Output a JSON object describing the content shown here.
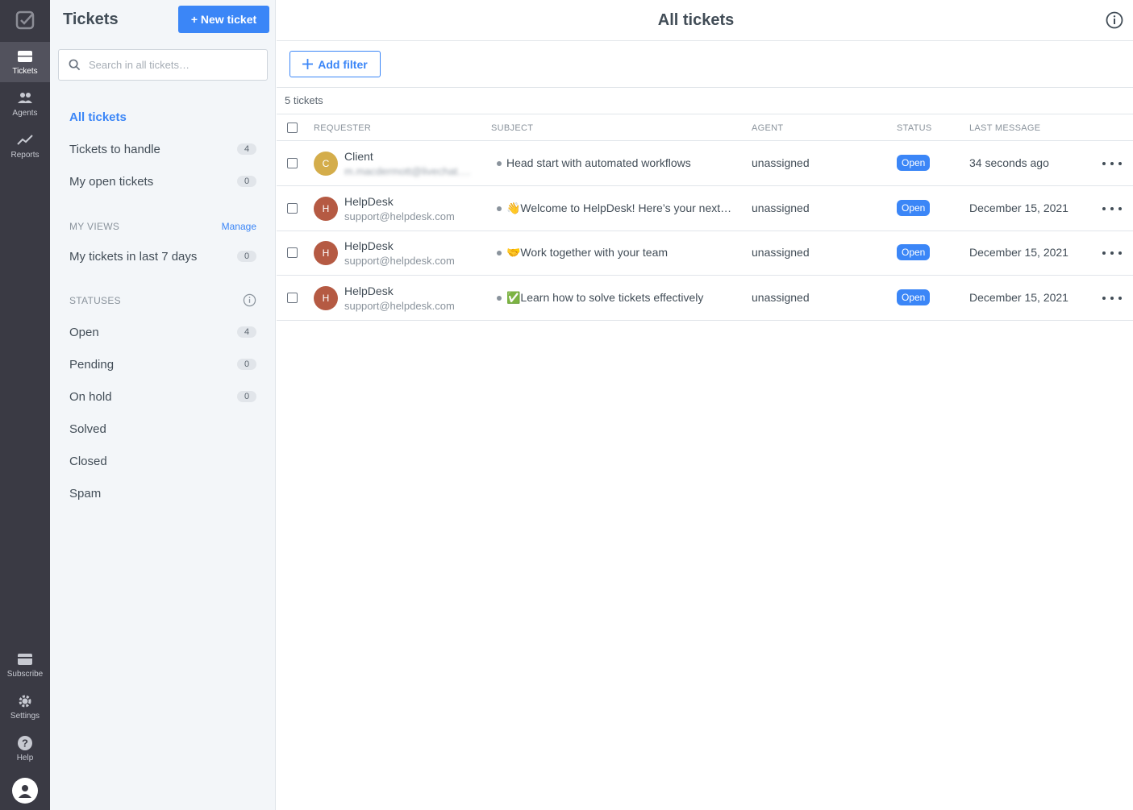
{
  "rail": {
    "items": [
      {
        "label": "Tickets",
        "icon": "ticket-icon"
      },
      {
        "label": "Agents",
        "icon": "agents-icon"
      },
      {
        "label": "Reports",
        "icon": "reports-icon"
      },
      {
        "label": "Subscribe",
        "icon": "subscribe-icon"
      },
      {
        "label": "Settings",
        "icon": "gear-icon"
      },
      {
        "label": "Help",
        "icon": "help-icon"
      }
    ]
  },
  "sidebar": {
    "title": "Tickets",
    "new_ticket_label": "+ New ticket",
    "search_placeholder": "Search in all tickets…",
    "nav": [
      {
        "label": "All tickets",
        "count": ""
      },
      {
        "label": "Tickets to handle",
        "count": "4"
      },
      {
        "label": "My open tickets",
        "count": "0"
      }
    ],
    "my_views": {
      "heading": "MY VIEWS",
      "manage_label": "Manage",
      "items": [
        {
          "label": "My tickets in last 7 days",
          "count": "0"
        }
      ]
    },
    "statuses": {
      "heading": "STATUSES",
      "items": [
        {
          "label": "Open",
          "count": "4"
        },
        {
          "label": "Pending",
          "count": "0"
        },
        {
          "label": "On hold",
          "count": "0"
        },
        {
          "label": "Solved",
          "count": ""
        },
        {
          "label": "Closed",
          "count": ""
        },
        {
          "label": "Spam",
          "count": ""
        }
      ]
    }
  },
  "main": {
    "title": "All tickets",
    "add_filter_label": "Add filter",
    "ticket_count": "5 tickets",
    "columns": [
      "REQUESTER",
      "SUBJECT",
      "AGENT",
      "STATUS",
      "LAST MESSAGE"
    ],
    "rows": [
      {
        "initial": "C",
        "avatar_color": "#d4ad4b",
        "name": "Client",
        "email": "m.macdermott@livechat.c…",
        "email_blurred": true,
        "subject": "Head start with automated workflows",
        "agent": "unassigned",
        "status": "Open",
        "last_message": "34 seconds ago"
      },
      {
        "initial": "H",
        "avatar_color": "#b55a43",
        "name": "HelpDesk",
        "email": "support@helpdesk.com",
        "email_blurred": false,
        "subject": "👋Welcome to HelpDesk! Here’s your next steps",
        "agent": "unassigned",
        "status": "Open",
        "last_message": "December 15, 2021"
      },
      {
        "initial": "H",
        "avatar_color": "#b55a43",
        "name": "HelpDesk",
        "email": "support@helpdesk.com",
        "email_blurred": false,
        "subject": "🤝Work together with your team",
        "agent": "unassigned",
        "status": "Open",
        "last_message": "December 15, 2021"
      },
      {
        "initial": "H",
        "avatar_color": "#b55a43",
        "name": "HelpDesk",
        "email": "support@helpdesk.com",
        "email_blurred": false,
        "subject": "✅Learn how to solve tickets effectively",
        "agent": "unassigned",
        "status": "Open",
        "last_message": "December 15, 2021"
      }
    ]
  },
  "colors": {
    "accent": "#3b86f7",
    "rail": "#3a3a44",
    "sidebar": "#f3f6f9"
  }
}
